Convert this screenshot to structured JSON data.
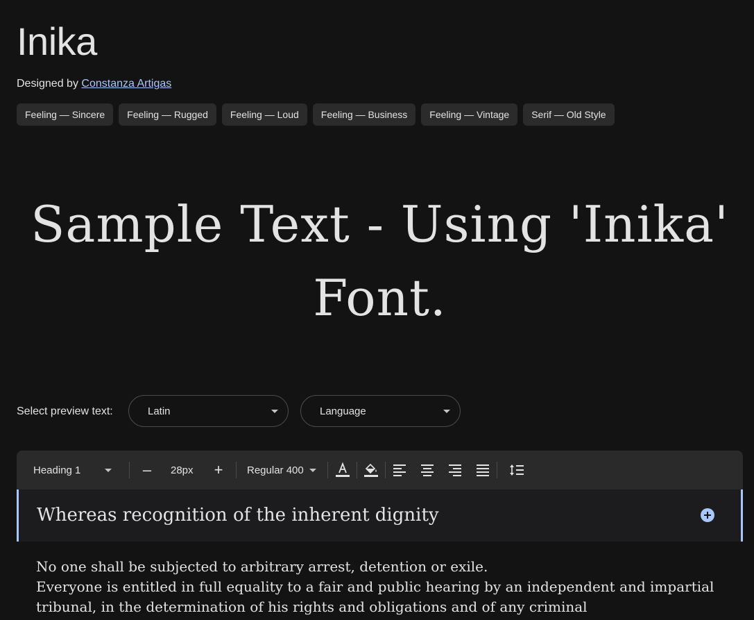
{
  "font": {
    "name": "Inika",
    "designed_by_label": "Designed by",
    "designer": "Constanza Artigas"
  },
  "tags": [
    "Feeling — Sincere",
    "Feeling — Rugged",
    "Feeling — Loud",
    "Feeling — Business",
    "Feeling — Vintage",
    "Serif — Old Style"
  ],
  "sample_text": "Sample Text - Using 'Inika' Font.",
  "preview": {
    "label": "Select preview text:",
    "script_select": "Latin",
    "language_select": "Language"
  },
  "toolbar": {
    "block_style": "Heading 1",
    "decrease": "–",
    "size": "28px",
    "increase": "+",
    "weight": "Regular 400",
    "icons": [
      "text-color-icon",
      "highlight-color-icon",
      "align-left-icon",
      "align-center-icon",
      "align-right-icon",
      "align-justify-icon",
      "line-height-icon"
    ]
  },
  "editor": {
    "heading": "Whereas recognition of the inherent dignity",
    "paragraphs": [
      "No one shall be subjected to arbitrary arrest, detention or exile.",
      "Everyone is entitled in full equality to a fair and public hearing by an independent and impartial tribunal, in the determination of his rights and obligations and of any criminal"
    ]
  },
  "colors": {
    "background": "#131313",
    "accent": "#a8c7fa",
    "toolbar": "#2a2a2a",
    "chip": "#2b2b2b"
  }
}
